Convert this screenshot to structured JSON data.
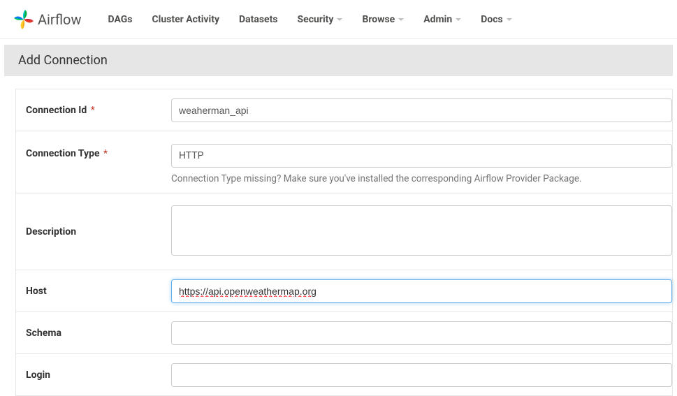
{
  "brand": "Airflow",
  "nav": {
    "dags": "DAGs",
    "cluster": "Cluster Activity",
    "datasets": "Datasets",
    "security": "Security",
    "browse": "Browse",
    "admin": "Admin",
    "docs": "Docs"
  },
  "page": {
    "title": "Add Connection"
  },
  "form": {
    "connection_id": {
      "label": "Connection Id",
      "value": "weaherman_api"
    },
    "connection_type": {
      "label": "Connection Type",
      "value": "HTTP",
      "hint": "Connection Type missing? Make sure you've installed the corresponding Airflow Provider Package."
    },
    "description": {
      "label": "Description",
      "value": ""
    },
    "host": {
      "label": "Host",
      "value": "https://api.openweathermap.org"
    },
    "schema": {
      "label": "Schema",
      "value": ""
    },
    "login": {
      "label": "Login",
      "value": ""
    }
  }
}
